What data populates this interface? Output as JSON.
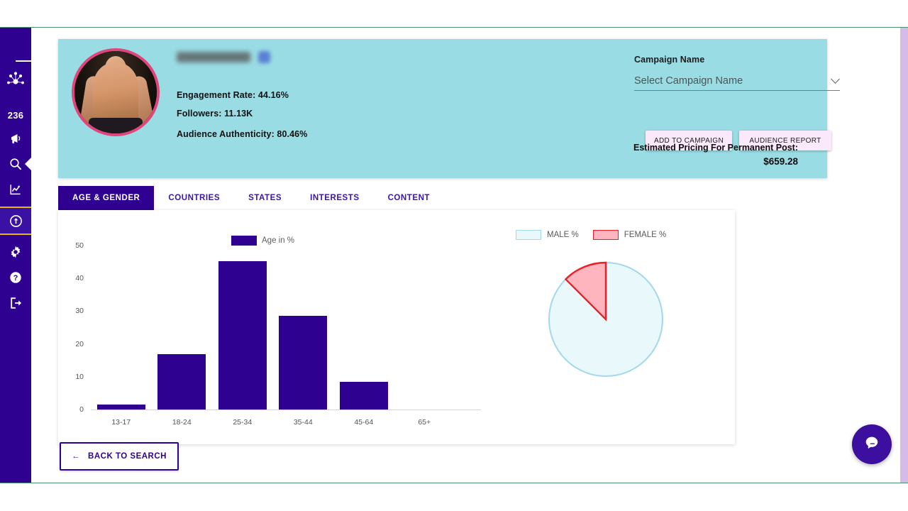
{
  "sidebar": {
    "items": [
      {
        "name": "menu-toggle",
        "icon": "hamburger-icon",
        "label": ""
      },
      {
        "name": "brand-logo",
        "icon": "network-nodes-icon",
        "label": ""
      },
      {
        "name": "credit-count",
        "icon": "",
        "label": "236"
      },
      {
        "name": "campaigns",
        "icon": "megaphone-icon",
        "label": ""
      },
      {
        "name": "search",
        "icon": "search-icon",
        "label": ""
      },
      {
        "name": "analytics",
        "icon": "chart-line-icon",
        "label": ""
      },
      {
        "name": "upload",
        "icon": "upload-circle-icon",
        "label": ""
      },
      {
        "name": "settings",
        "icon": "gear-icon",
        "label": ""
      },
      {
        "name": "help",
        "icon": "question-circle-icon",
        "label": ""
      },
      {
        "name": "logout",
        "icon": "logout-icon",
        "label": ""
      }
    ]
  },
  "profile": {
    "username_blurred": true,
    "verified_badge": true,
    "stats": {
      "engagement_rate": "Engagement Rate: 44.16%",
      "followers": "Followers: 11.13K",
      "audience_authenticity": "Audience Authenticity: 80.46%"
    }
  },
  "campaign": {
    "label": "Campaign Name",
    "select_value": "Select Campaign Name",
    "add_button": "ADD TO CAMPAIGN",
    "report_button": "AUDIENCE REPORT",
    "pricing_label": "Estimated Pricing For Permanent Post:",
    "pricing_value": "$659.28"
  },
  "tabs": [
    {
      "label": "AGE & GENDER",
      "active": true
    },
    {
      "label": "COUNTRIES",
      "active": false
    },
    {
      "label": "STATES",
      "active": false
    },
    {
      "label": "INTERESTS",
      "active": false
    },
    {
      "label": "CONTENT",
      "active": false
    }
  ],
  "footer": {
    "back_button": "BACK TO SEARCH",
    "back_arrow": "←"
  },
  "chat": {
    "icon": "chat-bubble-icon"
  },
  "colors": {
    "brand_purple": "#2e0191",
    "card_cyan": "#9adce4",
    "accent_pink": "#e0457b",
    "button_lilac": "#fae9fb",
    "divider_gold": "#e8b800",
    "female_red": "#ef1d26",
    "female_fill": "#ffb5bd",
    "male_border": "#a3d8ea",
    "male_fill": "#e9f8fb"
  },
  "chart_data": [
    {
      "type": "bar",
      "title": "",
      "legend": [
        "Age in %"
      ],
      "legend_position": "top-center",
      "categories": [
        "13-17",
        "18-24",
        "25-34",
        "35-44",
        "45-64",
        "65+"
      ],
      "values": [
        1.5,
        16.8,
        45.2,
        28.5,
        8.4,
        0
      ],
      "xlabel": "",
      "ylabel": "",
      "ylim": [
        0,
        50
      ],
      "yticks": [
        0,
        10,
        20,
        30,
        40,
        50
      ],
      "grid": false,
      "color": "#2e0191"
    },
    {
      "type": "pie",
      "title": "",
      "legend": [
        "MALE %",
        "FEMALE %"
      ],
      "legend_position": "top",
      "categories": [
        "MALE %",
        "FEMALE %"
      ],
      "values": [
        87.5,
        12.5
      ],
      "colors": [
        "#e9f8fb",
        "#ffb5bd"
      ],
      "border_colors": [
        "#a3d8ea",
        "#ef1d26"
      ],
      "start_angle_deg": 90,
      "direction": "counterclockwise"
    }
  ]
}
